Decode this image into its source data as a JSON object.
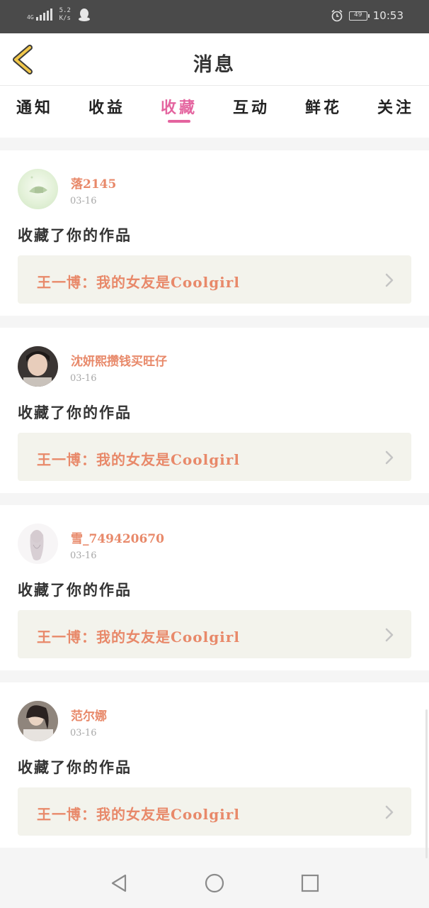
{
  "status_bar": {
    "network_type": "4G",
    "speed_value": "5.2",
    "speed_unit": "K/s",
    "battery": "49",
    "time": "10:53",
    "icons": [
      "signal-icon",
      "qq-icon",
      "alarm-icon",
      "battery-icon"
    ]
  },
  "header": {
    "title": "消息",
    "back_icon": "back-chevron-icon"
  },
  "tabs": [
    {
      "label": "通知",
      "active": false
    },
    {
      "label": "收益",
      "active": false
    },
    {
      "label": "收藏",
      "active": true
    },
    {
      "label": "互动",
      "active": false
    },
    {
      "label": "鲜花",
      "active": false
    },
    {
      "label": "关注",
      "active": false
    }
  ],
  "items": [
    {
      "username": "落2145",
      "date": "03-16",
      "action": "收藏了你的作品",
      "work_title": "王一博：我的女友是Coolgirl"
    },
    {
      "username": "沈妍熙攒钱买旺仔",
      "date": "03-16",
      "action": "收藏了你的作品",
      "work_title": "王一博：我的女友是Coolgirl"
    },
    {
      "username": "雪_749420670",
      "date": "03-16",
      "action": "收藏了你的作品",
      "work_title": "王一博：我的女友是Coolgirl"
    },
    {
      "username": "范尔娜",
      "date": "03-16",
      "action": "收藏了你的作品",
      "work_title": "王一博：我的女友是Coolgirl"
    }
  ],
  "nav_bar": {
    "buttons": [
      "back-triangle-icon",
      "home-circle-icon",
      "recents-square-icon"
    ]
  },
  "colors": {
    "accent_pink": "#e4649f",
    "name_orange": "#e8896a",
    "back_yellow": "#f2c84b"
  }
}
